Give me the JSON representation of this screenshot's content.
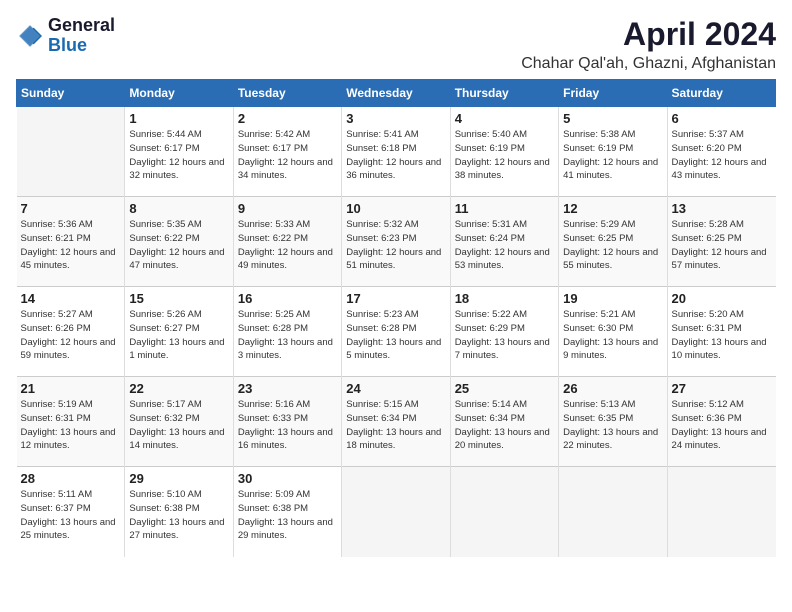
{
  "header": {
    "logo_general": "General",
    "logo_blue": "Blue",
    "month": "April 2024",
    "location": "Chahar Qal'ah, Ghazni, Afghanistan"
  },
  "columns": [
    "Sunday",
    "Monday",
    "Tuesday",
    "Wednesday",
    "Thursday",
    "Friday",
    "Saturday"
  ],
  "weeks": [
    [
      {
        "day": "",
        "sunrise": "",
        "sunset": "",
        "daylight": ""
      },
      {
        "day": "1",
        "sunrise": "Sunrise: 5:44 AM",
        "sunset": "Sunset: 6:17 PM",
        "daylight": "Daylight: 12 hours and 32 minutes."
      },
      {
        "day": "2",
        "sunrise": "Sunrise: 5:42 AM",
        "sunset": "Sunset: 6:17 PM",
        "daylight": "Daylight: 12 hours and 34 minutes."
      },
      {
        "day": "3",
        "sunrise": "Sunrise: 5:41 AM",
        "sunset": "Sunset: 6:18 PM",
        "daylight": "Daylight: 12 hours and 36 minutes."
      },
      {
        "day": "4",
        "sunrise": "Sunrise: 5:40 AM",
        "sunset": "Sunset: 6:19 PM",
        "daylight": "Daylight: 12 hours and 38 minutes."
      },
      {
        "day": "5",
        "sunrise": "Sunrise: 5:38 AM",
        "sunset": "Sunset: 6:19 PM",
        "daylight": "Daylight: 12 hours and 41 minutes."
      },
      {
        "day": "6",
        "sunrise": "Sunrise: 5:37 AM",
        "sunset": "Sunset: 6:20 PM",
        "daylight": "Daylight: 12 hours and 43 minutes."
      }
    ],
    [
      {
        "day": "7",
        "sunrise": "Sunrise: 5:36 AM",
        "sunset": "Sunset: 6:21 PM",
        "daylight": "Daylight: 12 hours and 45 minutes."
      },
      {
        "day": "8",
        "sunrise": "Sunrise: 5:35 AM",
        "sunset": "Sunset: 6:22 PM",
        "daylight": "Daylight: 12 hours and 47 minutes."
      },
      {
        "day": "9",
        "sunrise": "Sunrise: 5:33 AM",
        "sunset": "Sunset: 6:22 PM",
        "daylight": "Daylight: 12 hours and 49 minutes."
      },
      {
        "day": "10",
        "sunrise": "Sunrise: 5:32 AM",
        "sunset": "Sunset: 6:23 PM",
        "daylight": "Daylight: 12 hours and 51 minutes."
      },
      {
        "day": "11",
        "sunrise": "Sunrise: 5:31 AM",
        "sunset": "Sunset: 6:24 PM",
        "daylight": "Daylight: 12 hours and 53 minutes."
      },
      {
        "day": "12",
        "sunrise": "Sunrise: 5:29 AM",
        "sunset": "Sunset: 6:25 PM",
        "daylight": "Daylight: 12 hours and 55 minutes."
      },
      {
        "day": "13",
        "sunrise": "Sunrise: 5:28 AM",
        "sunset": "Sunset: 6:25 PM",
        "daylight": "Daylight: 12 hours and 57 minutes."
      }
    ],
    [
      {
        "day": "14",
        "sunrise": "Sunrise: 5:27 AM",
        "sunset": "Sunset: 6:26 PM",
        "daylight": "Daylight: 12 hours and 59 minutes."
      },
      {
        "day": "15",
        "sunrise": "Sunrise: 5:26 AM",
        "sunset": "Sunset: 6:27 PM",
        "daylight": "Daylight: 13 hours and 1 minute."
      },
      {
        "day": "16",
        "sunrise": "Sunrise: 5:25 AM",
        "sunset": "Sunset: 6:28 PM",
        "daylight": "Daylight: 13 hours and 3 minutes."
      },
      {
        "day": "17",
        "sunrise": "Sunrise: 5:23 AM",
        "sunset": "Sunset: 6:28 PM",
        "daylight": "Daylight: 13 hours and 5 minutes."
      },
      {
        "day": "18",
        "sunrise": "Sunrise: 5:22 AM",
        "sunset": "Sunset: 6:29 PM",
        "daylight": "Daylight: 13 hours and 7 minutes."
      },
      {
        "day": "19",
        "sunrise": "Sunrise: 5:21 AM",
        "sunset": "Sunset: 6:30 PM",
        "daylight": "Daylight: 13 hours and 9 minutes."
      },
      {
        "day": "20",
        "sunrise": "Sunrise: 5:20 AM",
        "sunset": "Sunset: 6:31 PM",
        "daylight": "Daylight: 13 hours and 10 minutes."
      }
    ],
    [
      {
        "day": "21",
        "sunrise": "Sunrise: 5:19 AM",
        "sunset": "Sunset: 6:31 PM",
        "daylight": "Daylight: 13 hours and 12 minutes."
      },
      {
        "day": "22",
        "sunrise": "Sunrise: 5:17 AM",
        "sunset": "Sunset: 6:32 PM",
        "daylight": "Daylight: 13 hours and 14 minutes."
      },
      {
        "day": "23",
        "sunrise": "Sunrise: 5:16 AM",
        "sunset": "Sunset: 6:33 PM",
        "daylight": "Daylight: 13 hours and 16 minutes."
      },
      {
        "day": "24",
        "sunrise": "Sunrise: 5:15 AM",
        "sunset": "Sunset: 6:34 PM",
        "daylight": "Daylight: 13 hours and 18 minutes."
      },
      {
        "day": "25",
        "sunrise": "Sunrise: 5:14 AM",
        "sunset": "Sunset: 6:34 PM",
        "daylight": "Daylight: 13 hours and 20 minutes."
      },
      {
        "day": "26",
        "sunrise": "Sunrise: 5:13 AM",
        "sunset": "Sunset: 6:35 PM",
        "daylight": "Daylight: 13 hours and 22 minutes."
      },
      {
        "day": "27",
        "sunrise": "Sunrise: 5:12 AM",
        "sunset": "Sunset: 6:36 PM",
        "daylight": "Daylight: 13 hours and 24 minutes."
      }
    ],
    [
      {
        "day": "28",
        "sunrise": "Sunrise: 5:11 AM",
        "sunset": "Sunset: 6:37 PM",
        "daylight": "Daylight: 13 hours and 25 minutes."
      },
      {
        "day": "29",
        "sunrise": "Sunrise: 5:10 AM",
        "sunset": "Sunset: 6:38 PM",
        "daylight": "Daylight: 13 hours and 27 minutes."
      },
      {
        "day": "30",
        "sunrise": "Sunrise: 5:09 AM",
        "sunset": "Sunset: 6:38 PM",
        "daylight": "Daylight: 13 hours and 29 minutes."
      },
      {
        "day": "",
        "sunrise": "",
        "sunset": "",
        "daylight": ""
      },
      {
        "day": "",
        "sunrise": "",
        "sunset": "",
        "daylight": ""
      },
      {
        "day": "",
        "sunrise": "",
        "sunset": "",
        "daylight": ""
      },
      {
        "day": "",
        "sunrise": "",
        "sunset": "",
        "daylight": ""
      }
    ]
  ]
}
